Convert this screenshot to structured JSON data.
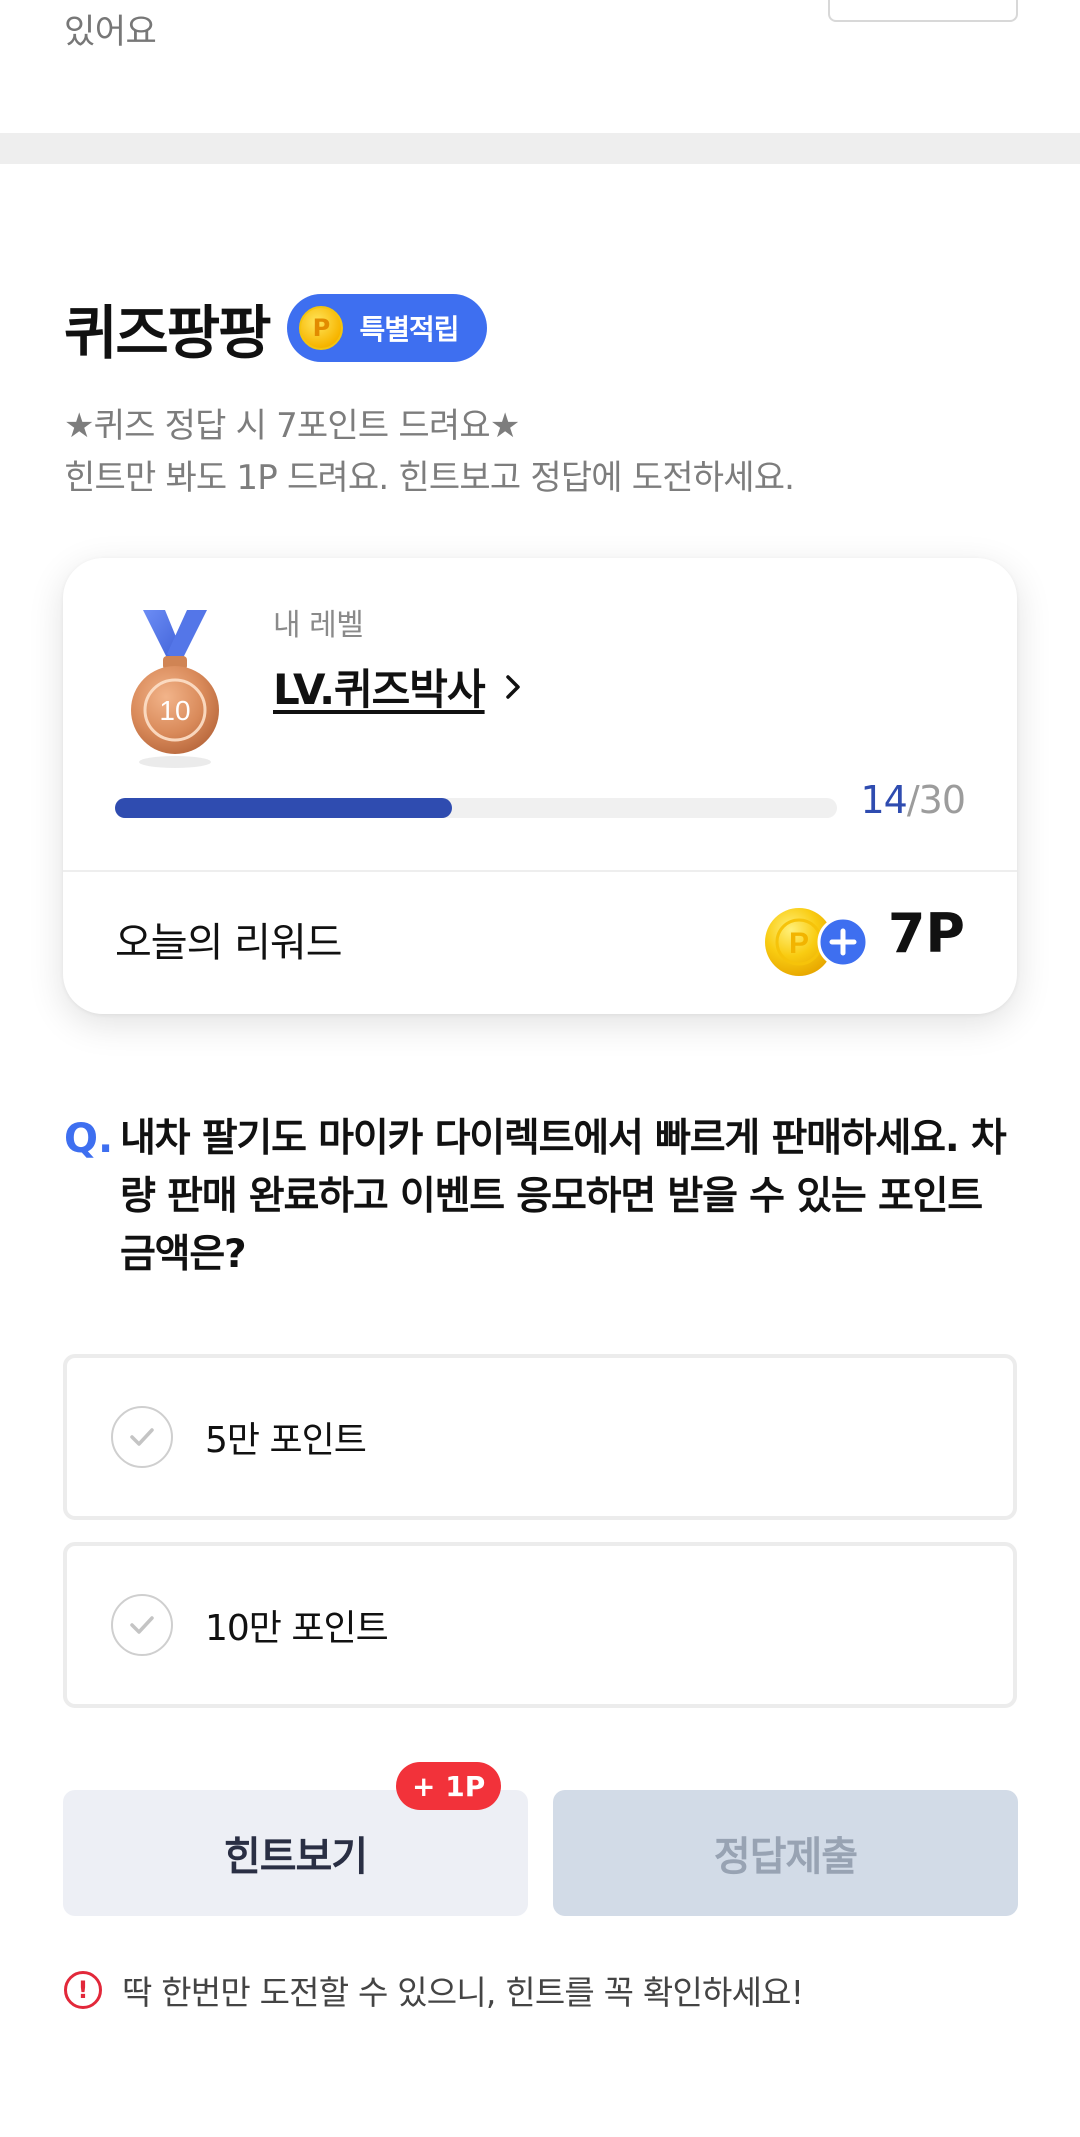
{
  "top": {
    "partial_text": "있어요"
  },
  "quiz": {
    "title": "퀴즈팡팡",
    "badge_label": "특별적립",
    "badge_coin_letter": "P",
    "desc_line1": "★퀴즈 정답 시 7포인트 드려요★",
    "desc_line2": "힌트만 봐도 1P 드려요. 힌트보고 정답에 도전하세요."
  },
  "level": {
    "caption": "내 레벨",
    "name": "LV.퀴즈박사",
    "medal_number": "10",
    "progress_current": "14",
    "progress_separator": "/",
    "progress_total": "30",
    "progress_fraction": 0.4667
  },
  "reward": {
    "label": "오늘의 리워드",
    "value": "7P"
  },
  "question": {
    "prefix": "Q.",
    "text": "내차 팔기도 마이카 다이렉트에서 빠르게 판매하세요. 차량 판매 완료하고 이벤트 응모하면 받을 수 있는 포인트 금액은?",
    "options": [
      {
        "label": "5만 포인트"
      },
      {
        "label": "10만 포인트"
      }
    ]
  },
  "buttons": {
    "hint_label": "힌트보기",
    "hint_badge": "+ 1P",
    "submit_label": "정답제출"
  },
  "notice": {
    "icon_text": "!",
    "text": "딱 한번만 도전할 수 있으니, 힌트를 꼭 확인하세요!"
  },
  "colors": {
    "accent_blue": "#3e6ff0",
    "progress_blue": "#2f4cb0",
    "alert_red": "#f2323a"
  },
  "icons": [
    "coin-icon",
    "medal-icon",
    "chevron-right-icon",
    "coin-plus-icon",
    "check-icon",
    "warning-icon"
  ]
}
